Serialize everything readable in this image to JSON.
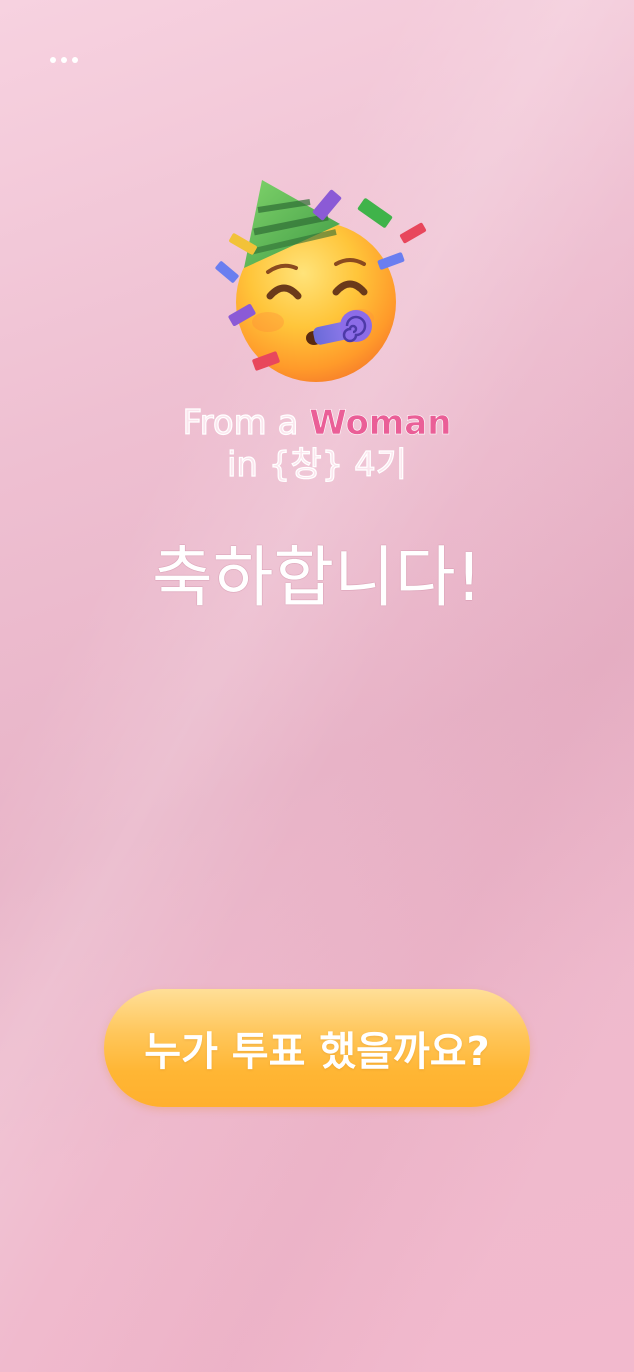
{
  "header": {
    "more_icon": "more-horizontal-icon"
  },
  "hero": {
    "emoji_icon": "party-face-icon"
  },
  "title": {
    "prefix": "From a ",
    "highlight": "Woman",
    "line2": "in {창} 4기"
  },
  "message": {
    "congrats": "축하합니다!"
  },
  "cta": {
    "label": "누가 투표 했을까요?"
  },
  "colors": {
    "highlight": "#ea5f97",
    "button": "#ffb634",
    "background": "#efbacd"
  }
}
